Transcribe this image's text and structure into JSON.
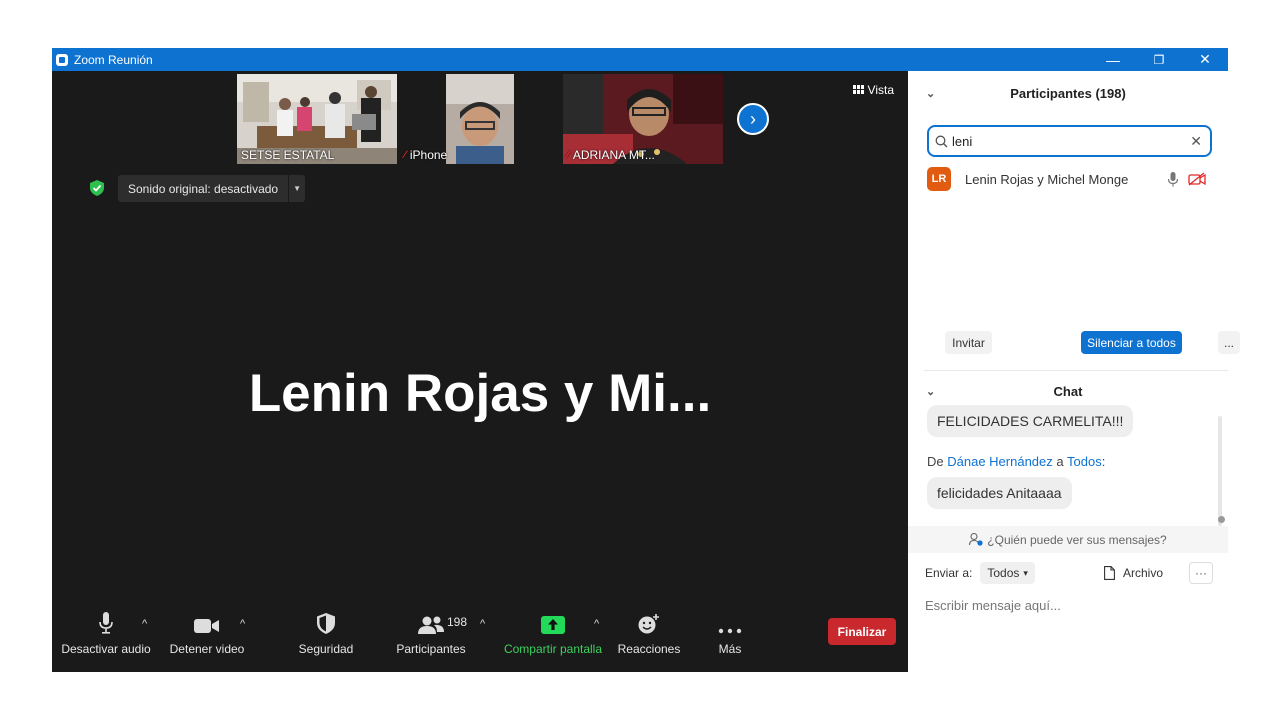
{
  "window": {
    "title": "Zoom Reunión",
    "minimize": "—",
    "restore": "❐",
    "close": "✕"
  },
  "thumbnails": [
    {
      "name": "SETSE ESTATAL",
      "muted": false
    },
    {
      "name": "iPhone",
      "muted": true
    },
    {
      "name": "ADRIANA MT...",
      "muted": true
    }
  ],
  "view": {
    "label": "Vista"
  },
  "sound": {
    "label": "Sonido original: desactivado"
  },
  "active_speaker": "Lenin Rojas y Mi...",
  "toolbar": {
    "audio": "Desactivar audio",
    "video": "Detener video",
    "security": "Seguridad",
    "participants": "Participantes",
    "participants_count": "198",
    "share": "Compartir pantalla",
    "reactions": "Reacciones",
    "more": "Más",
    "end": "Finalizar"
  },
  "participants_panel": {
    "header": "Participantes (198)",
    "search_value": "leni",
    "results": [
      {
        "initials": "LR",
        "name": "Lenin Rojas y Michel Monge"
      }
    ],
    "invite": "Invitar",
    "mute_all": "Silenciar a todos",
    "more": "..."
  },
  "chat": {
    "header": "Chat",
    "messages": [
      {
        "text": "FELICIDADES CARMELITA!!!"
      },
      {
        "prefix": "De",
        "from": "Dánae Hernández",
        "connector": "a",
        "to": "Todos",
        "suffix": ":",
        "text": "felicidades Anitaaaa"
      }
    ],
    "who_sees": "¿Quién puede ver sus mensajes?",
    "send_to_label": "Enviar a:",
    "send_to_value": "Todos",
    "file_label": "Archivo",
    "more": "···",
    "input_placeholder": "Escribir mensaje aquí..."
  },
  "colors": {
    "accent": "#0e72d1",
    "end_button": "#c9282d",
    "share_green": "#23d959",
    "avatar": "#e15b10"
  }
}
